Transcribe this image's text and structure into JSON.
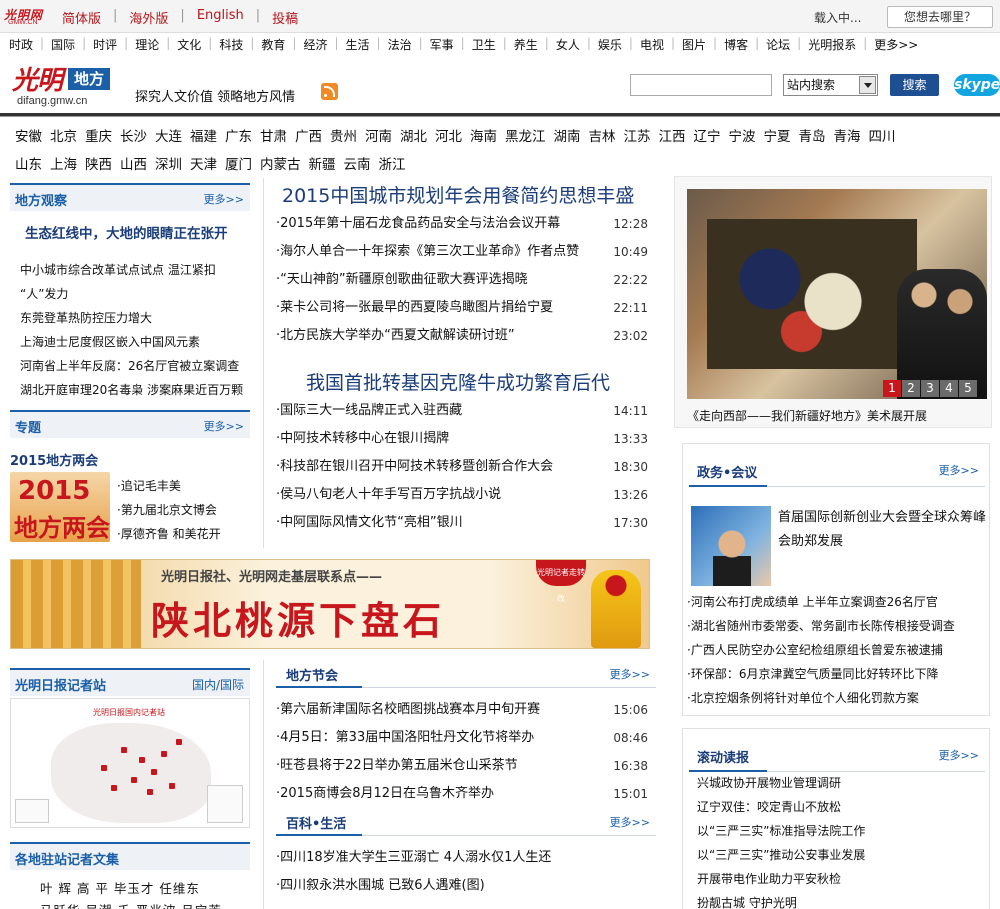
{
  "topbar": {
    "logo_text": "光明网",
    "logo_sub": "GMW.CN",
    "links": [
      "简体版",
      "海外版",
      "English",
      "投稿"
    ],
    "loading": "载入中...",
    "where": "您想去哪里？"
  },
  "channels": [
    "时政",
    "国际",
    "时评",
    "理论",
    "文化",
    "科技",
    "教育",
    "经济",
    "生活",
    "法治",
    "军事",
    "卫生",
    "养生",
    "女人",
    "娱乐",
    "电视",
    "图片",
    "博客",
    "论坛",
    "光明报系",
    "更多>>"
  ],
  "header": {
    "brand": "光明",
    "brand_tag": "地方",
    "url": "difang.gmw.cn",
    "slogan": "探究人文价值 领略地方风情",
    "search_placeholder": "",
    "search_scope": "站内搜索",
    "search_button": "搜索",
    "skype": "skype"
  },
  "regions": {
    "row1": [
      "安徽",
      "北京",
      "重庆",
      "长沙",
      "大连",
      "福建",
      "广东",
      "甘肃",
      "广西",
      "贵州",
      "河南",
      "湖北",
      "河北",
      "海南",
      "黑龙江",
      "湖南",
      "吉林",
      "江苏",
      "江西",
      "辽宁",
      "宁波",
      "宁夏",
      "青岛",
      "青海",
      "四川"
    ],
    "row2": [
      "山东",
      "上海",
      "陕西",
      "山西",
      "深圳",
      "天津",
      "厦门",
      "内蒙古",
      "新疆",
      "云南",
      "浙江"
    ]
  },
  "left": {
    "observe_title": "地方观察",
    "more": "更多>>",
    "observe_lead": "生态红线中，大地的眼睛正在张开",
    "observe_items": [
      "中小城市综合改革试点试点 温江紧扣",
      "“人”发力",
      "东莞登革热防控压力增大",
      "上海迪士尼度假区嵌入中国风元素",
      "河南省上半年反腐：26名厅官被立案调查",
      "湖北开庭审理20名毒枭 涉案麻果近百万颗"
    ],
    "special_title": "专题",
    "lianghui_title": "2015地方两会",
    "lianghui_img_year": "2015",
    "lianghui_img_words": "地方两会",
    "lianghui_items": [
      "·追记毛丰美",
      "·第九届北京文博会",
      "·厚德齐鲁 和美花开"
    ],
    "reporter_title": "光明日报记者站",
    "reporter_more": "国内/国际",
    "map_caption": "光明日报国内记者站",
    "writers_title": "各地驻站记者文集",
    "writers": [
      "叶 辉  高 平  毕玉才  任维东",
      "马跃华  吴潮 千  严兆波  吕宝芳"
    ]
  },
  "banner": {
    "sub": "光明日报社、光明网走基层联系点——",
    "main": "陕北桃源下盘石",
    "badge": "光明记者走转改"
  },
  "center": {
    "headline1": "2015中国城市规划年会用餐简约思想丰盛",
    "news1": [
      {
        "title": "·2015年第十届石龙食品药品安全与法治会议开幕",
        "time": "12:28"
      },
      {
        "title": "·海尔人单合一十年探索《第三次工业革命》作者点赞",
        "time": "10:49"
      },
      {
        "title": "·“天山神韵”新疆原创歌曲征歌大赛评选揭晓",
        "time": "22:22"
      },
      {
        "title": "·莱卡公司将一张最早的西夏陵鸟瞰图片捐给宁夏",
        "time": "22:11"
      },
      {
        "title": "·北方民族大学举办“西夏文献解读研讨班”",
        "time": "23:02"
      }
    ],
    "headline2": "我国首批转基因克隆牛成功繁育后代",
    "news2": [
      {
        "title": "·国际三大一线品牌正式入驻西藏",
        "time": "14:11"
      },
      {
        "title": "·中阿技术转移中心在银川揭牌",
        "time": "13:33"
      },
      {
        "title": "·科技部在银川召开中阿技术转移暨创新合作大会",
        "time": "18:30"
      },
      {
        "title": "·侯马八旬老人十年手写百万字抗战小说",
        "time": "13:26"
      },
      {
        "title": "·中阿国际风情文化节“亮相”银川",
        "time": "17:30"
      }
    ],
    "festival_title": "地方节会",
    "more": "更多>>",
    "festival": [
      {
        "title": "·第六届新津国际名校晒图挑战赛本月中旬开赛",
        "time": "15:06"
      },
      {
        "title": "·4月5日：第33届中国洛阳牡丹文化节将举办",
        "time": "08:46"
      },
      {
        "title": "·旺苍县将于22日举办第五届米仓山采茶节",
        "time": "16:38"
      },
      {
        "title": "·2015商博会8月12日在乌鲁木齐举办",
        "time": "15:01"
      }
    ],
    "baike_title": "百科•生活",
    "baike": [
      {
        "title": "·四川18岁准大学生三亚溺亡 4人溺水仅1人生还",
        "time": ""
      },
      {
        "title": "·四川叙永洪水围城 已致6人遇难(图)",
        "time": ""
      }
    ]
  },
  "right": {
    "pages": [
      "1",
      "2",
      "3",
      "4",
      "5"
    ],
    "slide_caption": "《走向西部——我们新疆好地方》美术展开展",
    "politics_title": "政务•会议",
    "more": "更多>>",
    "politics_feature": "首届国际创新创业大会暨全球众筹峰会助郑发展",
    "politics_items": [
      "·河南公布打虎成绩单 上半年立案调查26名厅官",
      "·湖北省随州市委常委、常务副市长陈传根接受调查",
      "·广西人民防空办公室纪检组原组长曾爱东被逮捕",
      "·环保部：6月京津冀空气质量同比好转环比下降",
      "·北京控烟条例将针对单位个人细化罚款方案"
    ],
    "rolling_title": "滚动读报",
    "rolling_items": [
      "兴城政协开展物业管理调研",
      "辽宁双佳：咬定青山不放松",
      "以“三严三实”标准指导法院工作",
      "以“三严三实”推动公安事业发展",
      "开展带电作业助力平安秋检",
      "扮靓古城 守护光明"
    ]
  },
  "colors": {
    "brand_red": "#c8161d",
    "brand_blue": "#1a5fa8",
    "title_navy": "#1a3d7a"
  }
}
